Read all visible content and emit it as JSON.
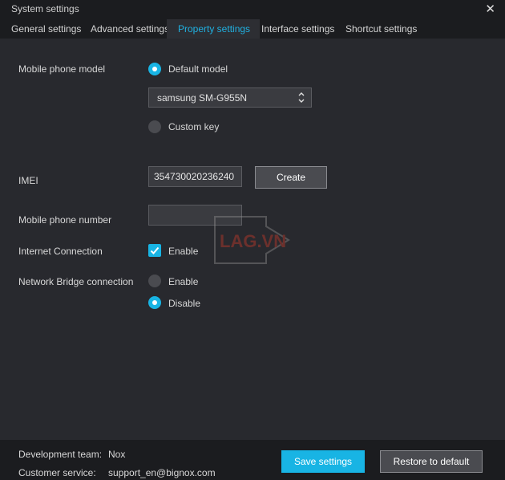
{
  "window": {
    "title": "System settings",
    "close_glyph": "✕"
  },
  "tabs": [
    {
      "label": "General settings"
    },
    {
      "label": "Advanced settings"
    },
    {
      "label": "Property settings"
    },
    {
      "label": "Interface settings"
    },
    {
      "label": "Shortcut settings"
    }
  ],
  "active_tab": "Property settings",
  "phone_model": {
    "label": "Mobile phone model",
    "default_option": "Default model",
    "default_selected": true,
    "selected_model": "samsung SM-G955N",
    "custom_option": "Custom key",
    "custom_selected": false
  },
  "imei": {
    "label": "IMEI",
    "value": "354730020236240",
    "create_label": "Create"
  },
  "phone_number": {
    "label": "Mobile phone number",
    "value": ""
  },
  "internet": {
    "label": "Internet Connection",
    "option": "Enable",
    "checked": true
  },
  "bridge": {
    "label": "Network Bridge connection",
    "enable_option": "Enable",
    "disable_option": "Disable",
    "selected": "Disable"
  },
  "watermark": {
    "text": "LAG.VN"
  },
  "footer": {
    "dev_label": "Development team:",
    "dev_value": "Nox",
    "support_label": "Customer service:",
    "support_value": "support_en@bignox.com",
    "save_label": "Save settings",
    "restore_label": "Restore to default"
  },
  "colors": {
    "accent": "#18b4e4",
    "background": "#28292e",
    "bar": "#1b1c1f"
  }
}
